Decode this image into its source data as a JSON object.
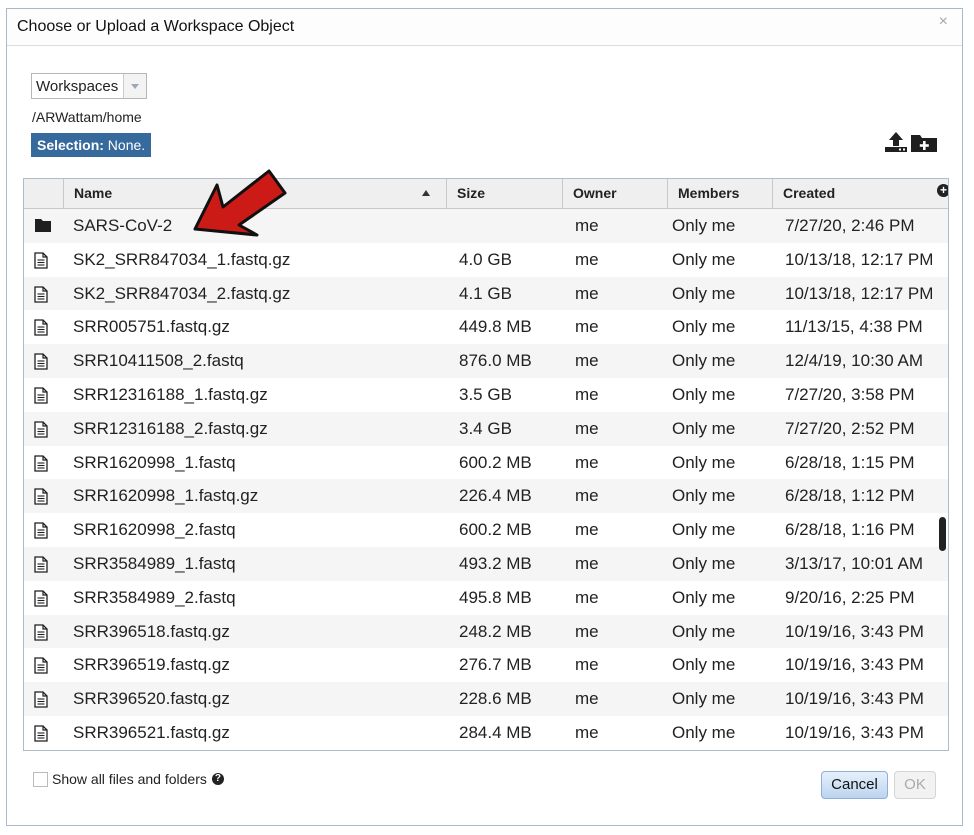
{
  "dialog": {
    "title": "Choose or Upload a Workspace Object",
    "close_label": "×"
  },
  "workspace_select": {
    "value": "Workspaces"
  },
  "path": "/ARWattam/home",
  "selection": {
    "label": "Selection:",
    "value": "None."
  },
  "icons": {
    "upload": "upload-icon",
    "new_folder": "new-folder-icon"
  },
  "grid": {
    "columns": {
      "name": "Name",
      "size": "Size",
      "owner": "Owner",
      "members": "Members",
      "created": "Created"
    },
    "add_column_label": "+",
    "rows": [
      {
        "type": "folder",
        "name": "SARS-CoV-2",
        "size": "",
        "owner": "me",
        "members": "Only me",
        "created": "7/27/20, 2:46 PM"
      },
      {
        "type": "file",
        "name": "SK2_SRR847034_1.fastq.gz",
        "size": "4.0 GB",
        "owner": "me",
        "members": "Only me",
        "created": "10/13/18, 12:17 PM"
      },
      {
        "type": "file",
        "name": "SK2_SRR847034_2.fastq.gz",
        "size": "4.1 GB",
        "owner": "me",
        "members": "Only me",
        "created": "10/13/18, 12:17 PM"
      },
      {
        "type": "file",
        "name": "SRR005751.fastq.gz",
        "size": "449.8 MB",
        "owner": "me",
        "members": "Only me",
        "created": "11/13/15, 4:38 PM"
      },
      {
        "type": "file",
        "name": "SRR10411508_2.fastq",
        "size": "876.0 MB",
        "owner": "me",
        "members": "Only me",
        "created": "12/4/19, 10:30 AM"
      },
      {
        "type": "file",
        "name": "SRR12316188_1.fastq.gz",
        "size": "3.5 GB",
        "owner": "me",
        "members": "Only me",
        "created": "7/27/20, 3:58 PM"
      },
      {
        "type": "file",
        "name": "SRR12316188_2.fastq.gz",
        "size": "3.4 GB",
        "owner": "me",
        "members": "Only me",
        "created": "7/27/20, 2:52 PM"
      },
      {
        "type": "file",
        "name": "SRR1620998_1.fastq",
        "size": "600.2 MB",
        "owner": "me",
        "members": "Only me",
        "created": "6/28/18, 1:15 PM"
      },
      {
        "type": "file",
        "name": "SRR1620998_1.fastq.gz",
        "size": "226.4 MB",
        "owner": "me",
        "members": "Only me",
        "created": "6/28/18, 1:12 PM"
      },
      {
        "type": "file",
        "name": "SRR1620998_2.fastq",
        "size": "600.2 MB",
        "owner": "me",
        "members": "Only me",
        "created": "6/28/18, 1:16 PM"
      },
      {
        "type": "file",
        "name": "SRR3584989_1.fastq",
        "size": "493.2 MB",
        "owner": "me",
        "members": "Only me",
        "created": "3/13/17, 10:01 AM"
      },
      {
        "type": "file",
        "name": "SRR3584989_2.fastq",
        "size": "495.8 MB",
        "owner": "me",
        "members": "Only me",
        "created": "9/20/16, 2:25 PM"
      },
      {
        "type": "file",
        "name": "SRR396518.fastq.gz",
        "size": "248.2 MB",
        "owner": "me",
        "members": "Only me",
        "created": "10/19/16, 3:43 PM"
      },
      {
        "type": "file",
        "name": "SRR396519.fastq.gz",
        "size": "276.7 MB",
        "owner": "me",
        "members": "Only me",
        "created": "10/19/16, 3:43 PM"
      },
      {
        "type": "file",
        "name": "SRR396520.fastq.gz",
        "size": "228.6 MB",
        "owner": "me",
        "members": "Only me",
        "created": "10/19/16, 3:43 PM"
      },
      {
        "type": "file",
        "name": "SRR396521.fastq.gz",
        "size": "284.4 MB",
        "owner": "me",
        "members": "Only me",
        "created": "10/19/16, 3:43 PM"
      }
    ]
  },
  "footer": {
    "show_all_label": "Show all files and folders",
    "help_label": "?",
    "cancel_label": "Cancel",
    "ok_label": "OK"
  },
  "colors": {
    "selection_bg": "#36699c",
    "arrow": "#cc1b17"
  }
}
